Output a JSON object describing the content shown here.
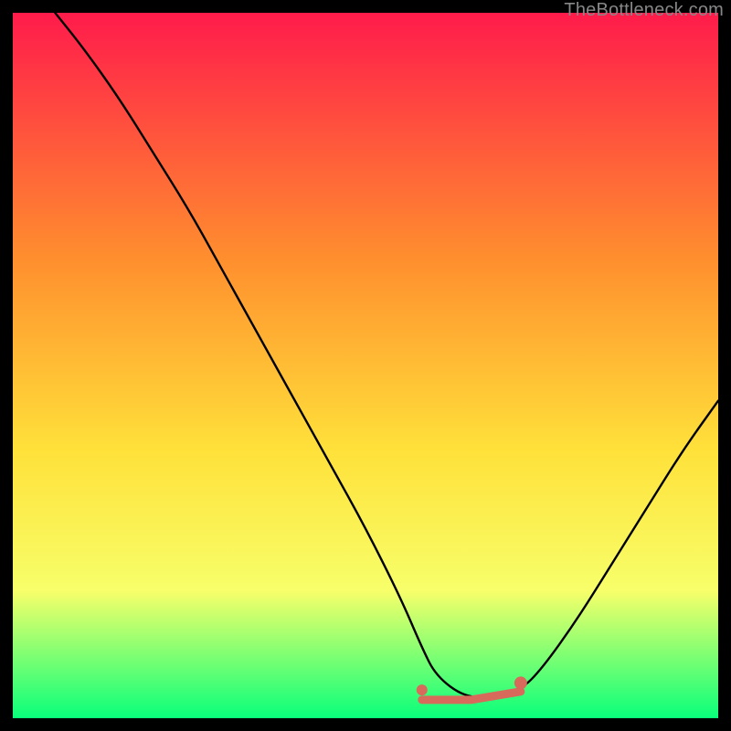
{
  "watermark": "TheBottleneck.com",
  "colors": {
    "gradient_top": "#ff1b4b",
    "gradient_mid1": "#ff8f2e",
    "gradient_mid2": "#ffe13a",
    "gradient_mid3": "#f7ff6a",
    "gradient_bottom": "#09ff7b",
    "curve": "#000000",
    "marker": "#d86a5c",
    "frame": "#000000"
  },
  "chart_data": {
    "type": "line",
    "title": "",
    "xlabel": "",
    "ylabel": "",
    "xlim": [
      0,
      100
    ],
    "ylim": [
      0,
      100
    ],
    "series": [
      {
        "name": "bottleneck-curve",
        "x": [
          6,
          10,
          15,
          20,
          25,
          30,
          35,
          40,
          45,
          50,
          55,
          58,
          60,
          64,
          68,
          72,
          75,
          80,
          85,
          90,
          95,
          100
        ],
        "y": [
          100,
          95,
          88,
          80,
          72,
          63,
          54,
          45,
          36,
          27,
          17,
          10,
          6,
          3,
          3,
          4,
          7,
          14,
          22,
          30,
          38,
          45
        ]
      }
    ],
    "markers": [
      {
        "name": "sweet-spot",
        "shape": "flat-segment",
        "x_start": 58,
        "x_end": 72,
        "y": 3
      },
      {
        "name": "sweet-spot-left-dot",
        "shape": "dot",
        "x": 58,
        "y": 4
      },
      {
        "name": "sweet-spot-right-dot",
        "shape": "dot",
        "x": 72,
        "y": 5
      }
    ],
    "background": {
      "type": "vertical-gradient",
      "stops": [
        {
          "pos": 0.0,
          "color": "#ff1b4b"
        },
        {
          "pos": 0.35,
          "color": "#ff8f2e"
        },
        {
          "pos": 0.62,
          "color": "#ffe13a"
        },
        {
          "pos": 0.82,
          "color": "#f7ff6a"
        },
        {
          "pos": 1.0,
          "color": "#09ff7b"
        }
      ]
    }
  }
}
